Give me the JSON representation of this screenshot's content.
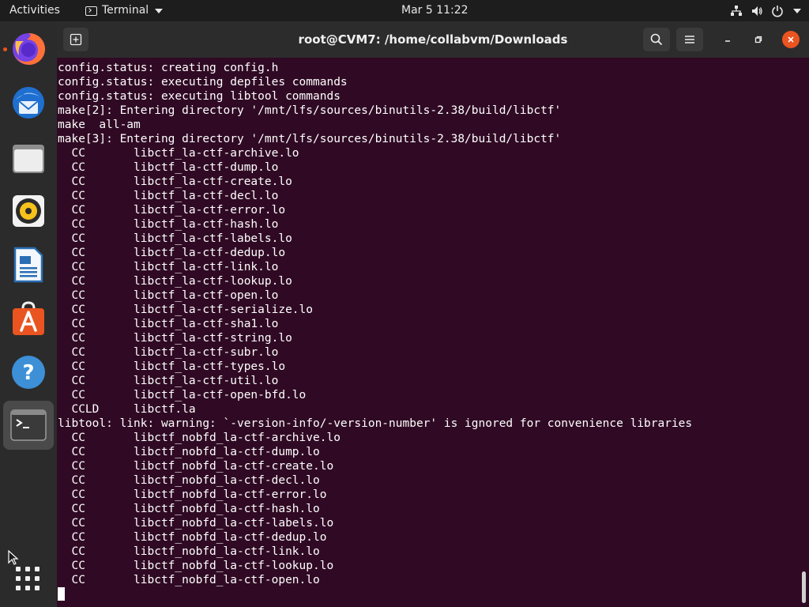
{
  "topbar": {
    "activities": "Activities",
    "app_menu": "Terminal",
    "clock": "Mar 5  11:22"
  },
  "dock": {
    "items": [
      "firefox",
      "thunderbird",
      "files",
      "rhythmbox",
      "libreoffice-writer",
      "ubuntu-software",
      "help",
      "terminal"
    ]
  },
  "window": {
    "title": "root@CVM7: /home/collabvm/Downloads"
  },
  "terminal": {
    "lines": [
      "config.status: creating config.h",
      "config.status: executing depfiles commands",
      "config.status: executing libtool commands",
      "make[2]: Entering directory '/mnt/lfs/sources/binutils-2.38/build/libctf'",
      "make  all-am",
      "make[3]: Entering directory '/mnt/lfs/sources/binutils-2.38/build/libctf'",
      "  CC       libctf_la-ctf-archive.lo",
      "  CC       libctf_la-ctf-dump.lo",
      "  CC       libctf_la-ctf-create.lo",
      "  CC       libctf_la-ctf-decl.lo",
      "  CC       libctf_la-ctf-error.lo",
      "  CC       libctf_la-ctf-hash.lo",
      "  CC       libctf_la-ctf-labels.lo",
      "  CC       libctf_la-ctf-dedup.lo",
      "  CC       libctf_la-ctf-link.lo",
      "  CC       libctf_la-ctf-lookup.lo",
      "  CC       libctf_la-ctf-open.lo",
      "  CC       libctf_la-ctf-serialize.lo",
      "  CC       libctf_la-ctf-sha1.lo",
      "  CC       libctf_la-ctf-string.lo",
      "  CC       libctf_la-ctf-subr.lo",
      "  CC       libctf_la-ctf-types.lo",
      "  CC       libctf_la-ctf-util.lo",
      "  CC       libctf_la-ctf-open-bfd.lo",
      "  CCLD     libctf.la",
      "libtool: link: warning: `-version-info/-version-number' is ignored for convenience libraries",
      "  CC       libctf_nobfd_la-ctf-archive.lo",
      "  CC       libctf_nobfd_la-ctf-dump.lo",
      "  CC       libctf_nobfd_la-ctf-create.lo",
      "  CC       libctf_nobfd_la-ctf-decl.lo",
      "  CC       libctf_nobfd_la-ctf-error.lo",
      "  CC       libctf_nobfd_la-ctf-hash.lo",
      "  CC       libctf_nobfd_la-ctf-labels.lo",
      "  CC       libctf_nobfd_la-ctf-dedup.lo",
      "  CC       libctf_nobfd_la-ctf-link.lo",
      "  CC       libctf_nobfd_la-ctf-lookup.lo",
      "  CC       libctf_nobfd_la-ctf-open.lo"
    ]
  },
  "colors": {
    "terminal_bg": "#300a24",
    "accent": "#e95420",
    "topbar_bg": "#1d1d1d",
    "dock_bg": "#2b2b2b"
  }
}
